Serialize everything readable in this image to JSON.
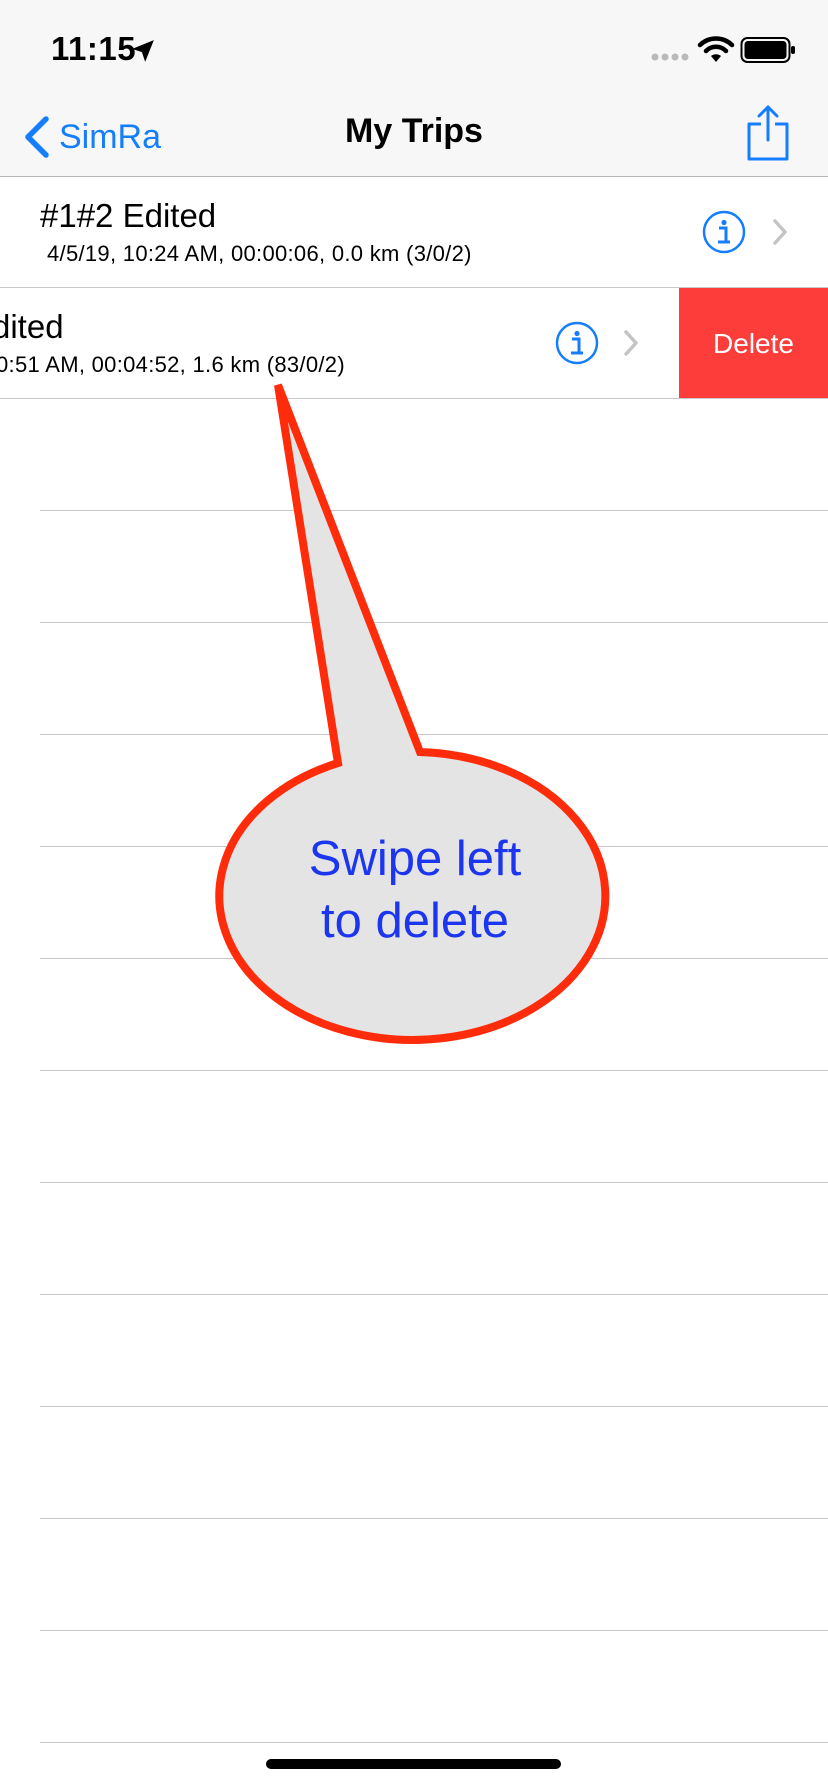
{
  "status_bar": {
    "time": "11:15",
    "icons": [
      "location-arrow-icon",
      "signal-icon",
      "wifi-icon",
      "battery-icon"
    ]
  },
  "nav": {
    "back_label": "SimRa",
    "title": "My Trips",
    "share_icon": "share-icon"
  },
  "trips": [
    {
      "title": "#1#2 Edited",
      "subtitle": "4/5/19, 10:24 AM, 00:00:06, 0.0 km (3/0/2)"
    },
    {
      "title": "dited",
      "subtitle": "0:51 AM, 00:04:52, 1.6 km (83/0/2)",
      "swiped": true,
      "delete_label": "Delete"
    }
  ],
  "callout": {
    "line1": "Swipe left",
    "line2": "to delete"
  },
  "colors": {
    "accent": "#147efb",
    "delete": "#fc3d39",
    "callout_border": "#fe2c0b",
    "callout_fill": "#e4e4e4",
    "callout_text": "#1c35ef"
  }
}
